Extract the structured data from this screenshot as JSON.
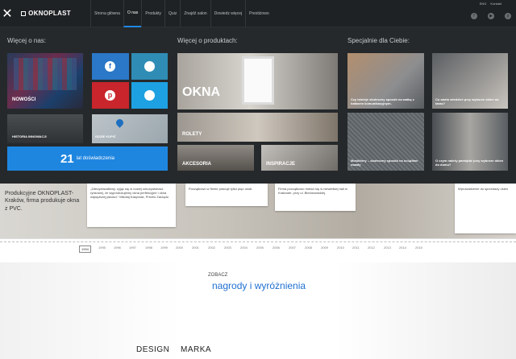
{
  "header": {
    "close_glyph": "✕",
    "logo": "OKNOPLAST",
    "nav": [
      "Strona główna",
      "O nas",
      "Produkty",
      "Quiz",
      "Znajdź salon",
      "Dowiedz więcej",
      "Prestiżowo"
    ],
    "nav_active_index": 1,
    "lang": [
      "ENG",
      "Kontakt"
    ],
    "social_icons": [
      "facebook-icon",
      "youtube-icon",
      "pinterest-icon"
    ]
  },
  "mega_menu": {
    "col1_title": "Więcej o nas:",
    "col2_title": "Więcej o produktach:",
    "col3_title": "Specjalnie dla Ciebie:",
    "tiles": {
      "nowosci": "NOWOŚCI",
      "historia": "HISTORIA INNOWACJI",
      "gdzie_kupic": "GDZIE KUPIĆ",
      "years_number": "21",
      "years_text": "lat doświadczenia",
      "okna": "OKNA",
      "rolety": "ROLETY",
      "akcesoria": "AKCESORIA",
      "inspiracje": "INSPIRACJE",
      "article1": "Czy istnieje skuteczny sposób na walkę z hałasem komunikacyjnym.",
      "article2": "Co warto wiedzieć przy wyborze okien na taras?",
      "article3": "Moskitiery – skuteczny sposób na uciążliwe owady",
      "article4": "O czym należy pamiętać przy wyborze okien do domu?"
    },
    "social_tiles": [
      "facebook-icon",
      "instagram-icon",
      "pinterest-icon",
      "twitter-icon"
    ]
  },
  "page": {
    "intro_text": "Produkcyjne OKNOPLAST-Kraków, firma produkuje okna z PVC.",
    "card1": "„Zdecydowaliśmy, zyjąc się w nowej rzeczywistości rynkowej, że wyprodukujemy okna perfekcyjne i okna najwyższej jakości.” Mikołaj Kasprzak, Prezes Zarządu",
    "card2": "Początkowo w firmie pracuje tylko pięć osób.",
    "card3": "Firma początkowo mieści się w niewielkiej hali w Krakowie, przy ul. Bieżanowskiej.",
    "card4": "Wprowadzenie do sprzedaży okien",
    "years": [
      "1994",
      "1995",
      "1996",
      "1997",
      "1998",
      "1999",
      "2000",
      "2001",
      "2002",
      "2003",
      "2004",
      "2005",
      "2006",
      "2007",
      "2008",
      "2009",
      "2010",
      "2011",
      "2012",
      "2013",
      "2014",
      "2015"
    ],
    "active_year": "1994",
    "awards_small": "ZOBACZ",
    "awards_title": "nagrody i wyróżnienia",
    "design": "DESIGN",
    "marka": "MARKA"
  }
}
